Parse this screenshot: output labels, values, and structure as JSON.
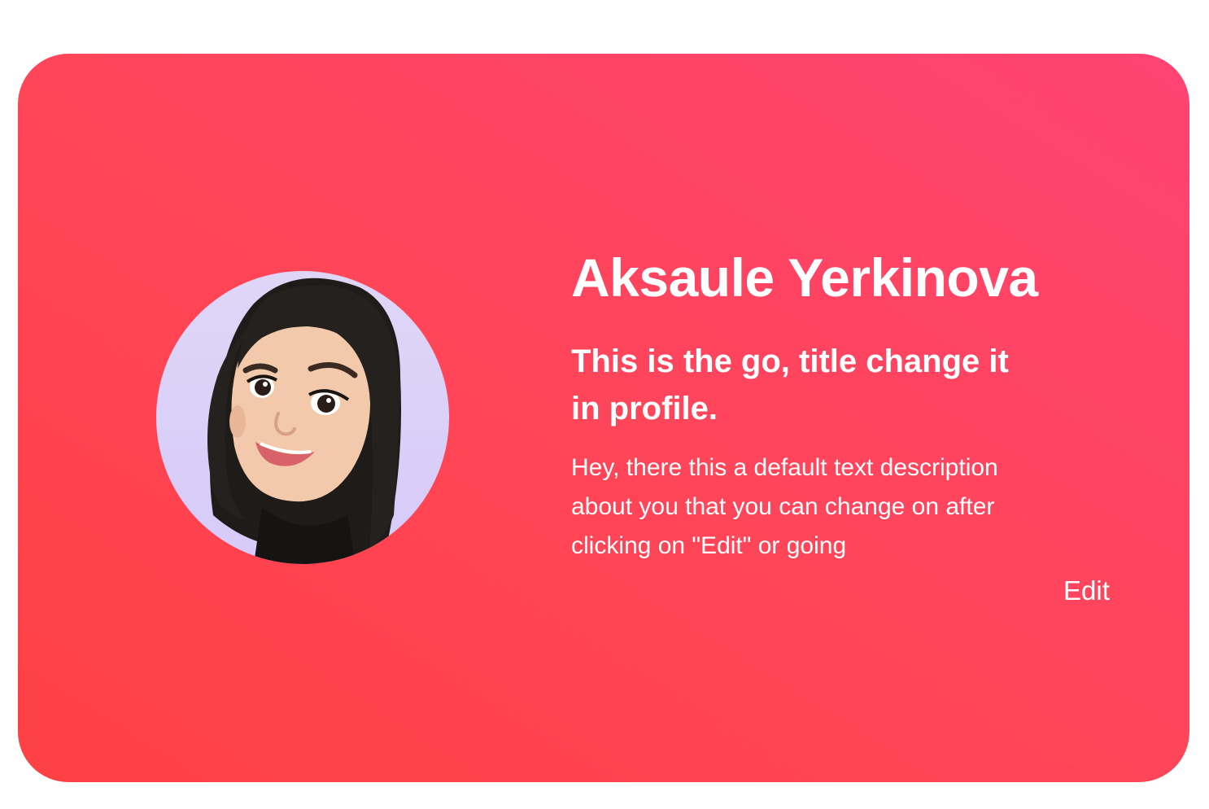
{
  "profile": {
    "name": "Aksaule Yerkinova",
    "title": "This is the go, title change it in profile.",
    "description": "Hey, there this a default text description about you that you can change on after clicking on \"Edit\" or going",
    "edit_label": "Edit",
    "avatar_icon": "memoji-avatar-icon"
  },
  "colors": {
    "card_gradient_start": "#ff4044",
    "card_gradient_end": "#ff4373",
    "avatar_background": "#dcd2f8",
    "text": "#ffffff"
  }
}
